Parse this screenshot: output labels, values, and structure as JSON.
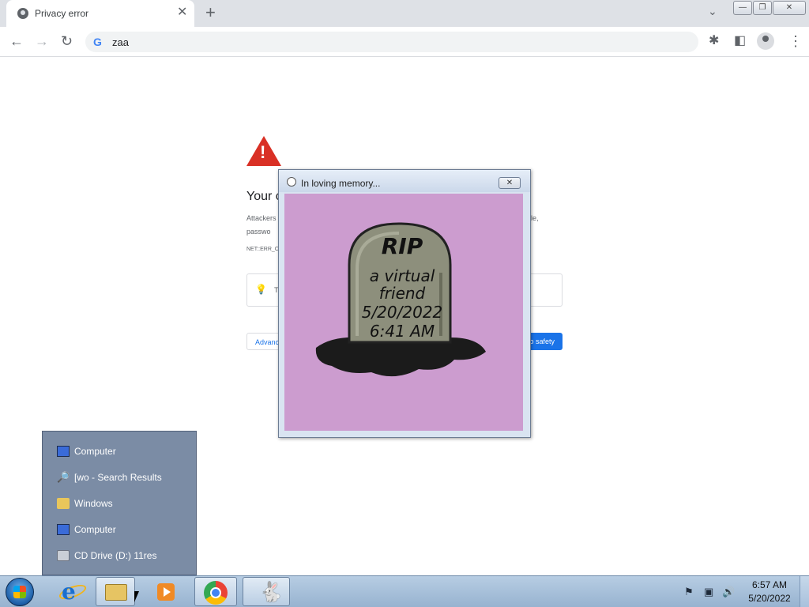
{
  "browser": {
    "tab_title": "Privacy error",
    "tab_close": "✕",
    "new_tab": "+",
    "tab_search": "⌄",
    "url": "zaa",
    "google_g": "G"
  },
  "window_controls": {
    "minimize": "—",
    "restore": "❐",
    "close": "✕"
  },
  "interstitial": {
    "heading": "Your c",
    "para1_start": "Attackers",
    "para1_end": "le,",
    "para2_start": "passwo",
    "error_code": "NET::ERR_C",
    "tip_start": "T",
    "advanced_label": "Advanc",
    "safety_label": "o safety"
  },
  "dialog": {
    "title": "In loving memory...",
    "close": "✕",
    "tombstone": {
      "rip": "RIP",
      "line1": "a virtual",
      "line2": "friend",
      "line3": "5/20/2022",
      "line4": "6:41 AM"
    }
  },
  "jumplist": {
    "items": [
      {
        "label": "Computer",
        "icon": "computer-icon"
      },
      {
        "label": "[wo - Search Results",
        "icon": "search-icon"
      },
      {
        "label": "Windows",
        "icon": "folder-icon"
      },
      {
        "label": "Computer",
        "icon": "computer-icon"
      },
      {
        "label": "CD Drive (D:) 11res",
        "icon": "cd-drive-icon"
      }
    ]
  },
  "taskbar": {
    "time": "6:57 AM",
    "date": "5/20/2022",
    "ie_letter": "e",
    "tray_flag": "⚑",
    "tray_network": "▣",
    "tray_volume": "🔊",
    "bunny": "🐇"
  },
  "colors": {
    "warning_red": "#d93025",
    "chrome_blue": "#1a73e8",
    "dialog_canvas": "#cc9ccf",
    "jumplist_bg": "#7b8ca5"
  }
}
